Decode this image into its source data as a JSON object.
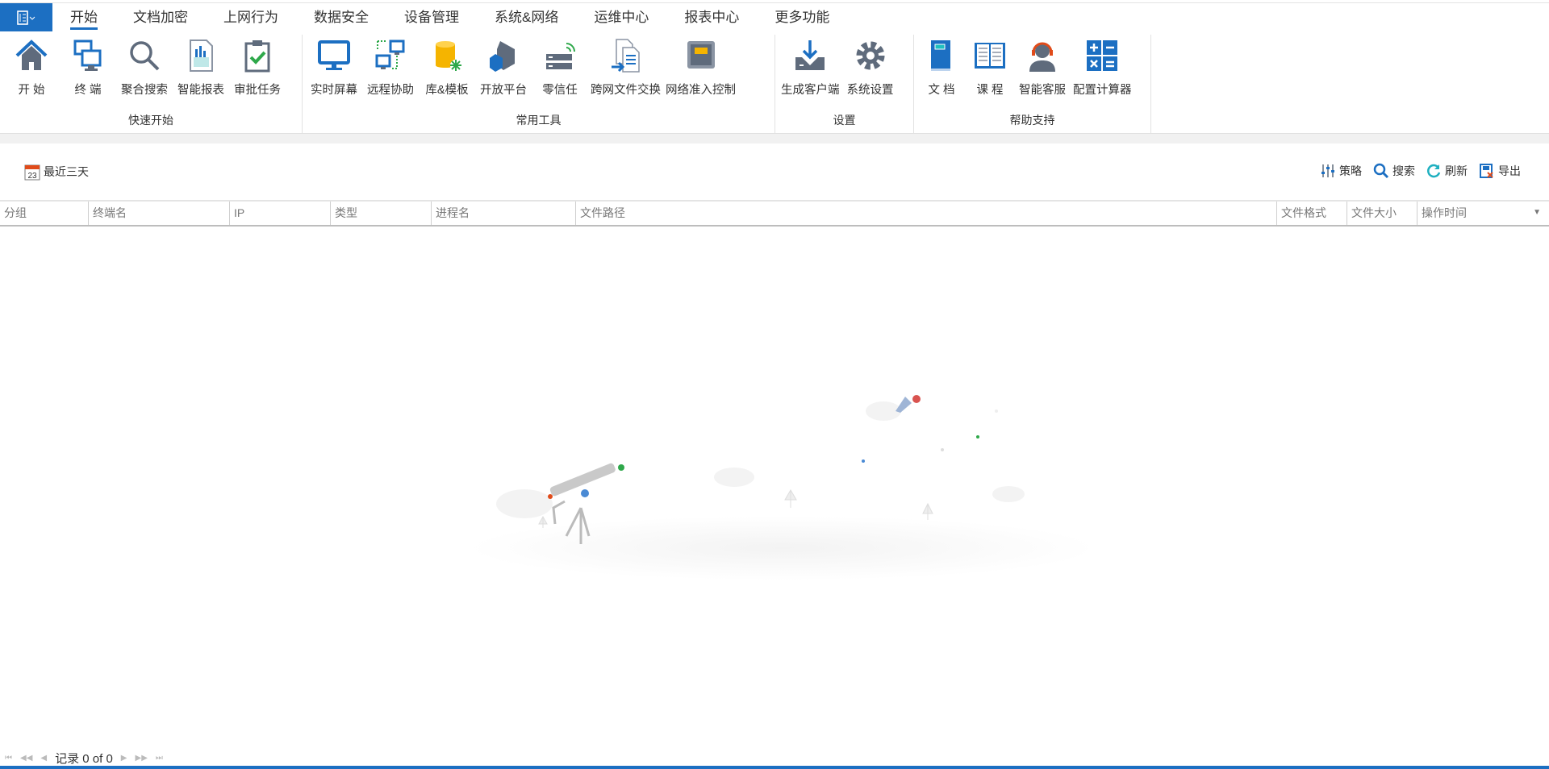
{
  "menu": {
    "app_button_icon": "ribbon-menu-icon",
    "tabs": [
      "开始",
      "文档加密",
      "上网行为",
      "数据安全",
      "设备管理",
      "系统&网络",
      "运维中心",
      "报表中心",
      "更多功能"
    ],
    "active_tab": "开始"
  },
  "ribbon": {
    "groups": [
      {
        "label": "快速开始",
        "items": [
          {
            "label": "开 始",
            "icon": "home-icon"
          },
          {
            "label": "终 端",
            "icon": "terminals-icon"
          },
          {
            "label": "聚合搜索",
            "icon": "search-icon"
          },
          {
            "label": "智能报表",
            "icon": "report-icon"
          },
          {
            "label": "审批任务",
            "icon": "approval-clipboard-icon"
          }
        ]
      },
      {
        "label": "常用工具",
        "items": [
          {
            "label": "实时屏幕",
            "icon": "monitor-icon"
          },
          {
            "label": "远程协助",
            "icon": "remote-assist-icon"
          },
          {
            "label": "库&模板",
            "icon": "database-icon"
          },
          {
            "label": "开放平台",
            "icon": "open-platform-icon"
          },
          {
            "label": "零信任",
            "icon": "zero-trust-server-icon"
          },
          {
            "label": "跨网文件交换",
            "icon": "file-exchange-icon"
          },
          {
            "label": "网络准入控制",
            "icon": "network-port-icon"
          }
        ]
      },
      {
        "label": "设置",
        "items": [
          {
            "label": "生成客户端",
            "icon": "download-client-icon"
          },
          {
            "label": "系统设置",
            "icon": "gear-icon"
          }
        ]
      },
      {
        "label": "帮助支持",
        "items": [
          {
            "label": "文 档",
            "icon": "book-icon"
          },
          {
            "label": "课 程",
            "icon": "open-book-icon"
          },
          {
            "label": "智能客服",
            "icon": "headset-agent-icon"
          },
          {
            "label": "配置计算器",
            "icon": "calculator-icon"
          }
        ]
      }
    ]
  },
  "toolbar": {
    "date_range": "最近三天",
    "calendar_day": "23",
    "strategy": "策略",
    "search": "搜索",
    "refresh": "刷新",
    "export": "导出"
  },
  "table": {
    "columns": [
      "分组",
      "终端名",
      "IP",
      "类型",
      "进程名",
      "文件路径",
      "文件格式",
      "文件大小",
      "操作时间"
    ],
    "rows": []
  },
  "pager": {
    "text": "记录 0 of 0"
  },
  "colors": {
    "accent": "#1c6fc2",
    "icon_gray": "#5f6b7c"
  }
}
